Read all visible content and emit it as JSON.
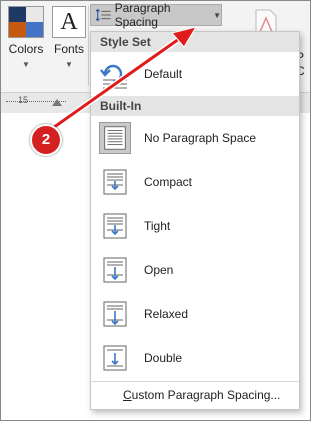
{
  "ribbon": {
    "colors_label": "Colors",
    "fonts_label": "Fonts",
    "fonts_glyph": "A",
    "paragraph_spacing_label": "Paragraph Spacing",
    "ruler_number": "15",
    "right_label_top": "P",
    "right_label_bottom": "C"
  },
  "menu": {
    "style_set_header": "Style Set",
    "default_label": "Default",
    "builtin_header": "Built-In",
    "items": [
      {
        "label": "No Paragraph Space",
        "icon": "no-paragraph-space-icon"
      },
      {
        "label": "Compact",
        "icon": "compact-spacing-icon"
      },
      {
        "label": "Tight",
        "icon": "tight-spacing-icon"
      },
      {
        "label": "Open",
        "icon": "open-spacing-icon"
      },
      {
        "label": "Relaxed",
        "icon": "relaxed-spacing-icon"
      },
      {
        "label": "Double",
        "icon": "double-spacing-icon"
      }
    ],
    "footer_prefix": "",
    "footer_underlined": "C",
    "footer_rest": "ustom Paragraph Spacing..."
  },
  "annotation": {
    "step_number": "2",
    "color": "#d42020"
  },
  "colors": {
    "accent_blue": "#2b579a",
    "arrow_blue": "#3c78c8"
  }
}
